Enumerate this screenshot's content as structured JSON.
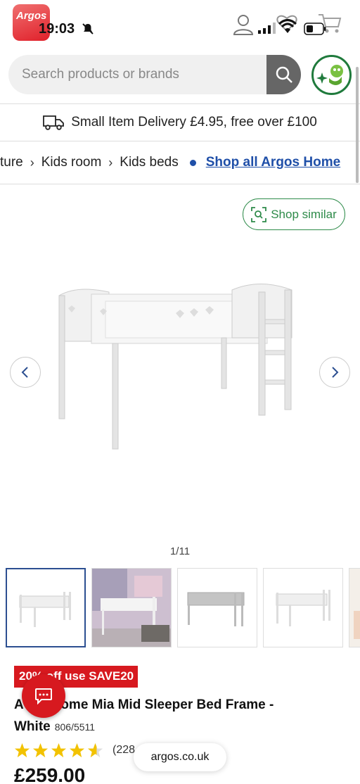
{
  "status_bar": {
    "time": "19:03",
    "app_icon_label": "Argos"
  },
  "search": {
    "placeholder": "Search products or brands"
  },
  "delivery_banner": {
    "text": "Small Item Delivery £4.95, free over £100"
  },
  "breadcrumb": {
    "items": [
      "ture",
      "Kids room",
      "Kids beds"
    ],
    "shop_all_link": "Shop all Argos Home"
  },
  "shop_similar": {
    "label": "Shop similar"
  },
  "gallery": {
    "counter": "1/11",
    "thumbnail_count": 5
  },
  "product": {
    "offer": "20% off use SAVE20",
    "title_lead": "A",
    "title_rest": "ome Mia Mid Sleeper Bed Frame -",
    "title_line2": "White",
    "sku": "806/5511",
    "rating": 4.5,
    "rating_count": "(228",
    "price": "£259.00"
  },
  "browser": {
    "url": "argos.co.uk"
  },
  "colors": {
    "brand_red": "#d7191f",
    "link_blue": "#1f4fa8",
    "green": "#2e8b4a",
    "star_yellow": "#f2c200"
  },
  "icons": [
    "mute-icon",
    "account-icon",
    "signal-icon",
    "wifi-icon",
    "heart-icon",
    "battery-icon",
    "cart-icon",
    "search-icon",
    "delivery-van-icon",
    "chevron-right-icon",
    "visual-search-icon",
    "chevron-left-icon",
    "chat-icon",
    "star-icon"
  ]
}
